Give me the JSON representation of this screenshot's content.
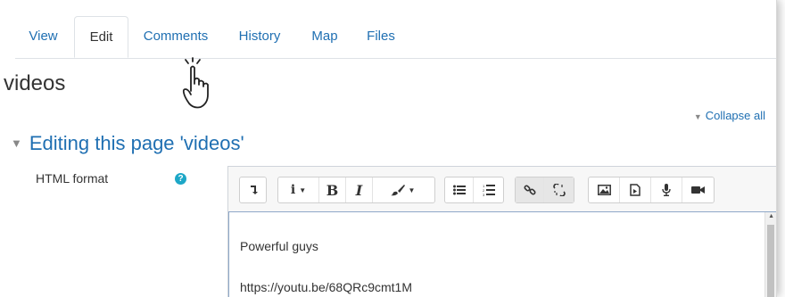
{
  "tabs": [
    {
      "label": "View"
    },
    {
      "label": "Edit"
    },
    {
      "label": "Comments"
    },
    {
      "label": "History"
    },
    {
      "label": "Map"
    },
    {
      "label": "Files"
    }
  ],
  "active_tab": "Edit",
  "page": {
    "title": "videos"
  },
  "collapse_all": "Collapse all",
  "section": {
    "heading": "Editing this page 'videos'"
  },
  "field": {
    "label": "HTML format",
    "help_icon": "question-icon"
  },
  "toolbar": {
    "icons": [
      "toggle-toolbar-icon",
      "info-icon",
      "bold-icon",
      "italic-icon",
      "paintbrush-icon",
      "bullet-list-icon",
      "numbered-list-icon",
      "link-icon",
      "unlink-icon",
      "image-icon",
      "media-file-icon",
      "microphone-icon",
      "video-camera-icon"
    ],
    "bold": "B",
    "italic": "I"
  },
  "editor": {
    "lines": [
      "Powerful guys",
      "https://youtu.be/68QRc9cmt1M"
    ]
  },
  "colors": {
    "link": "#1f6fb2",
    "help": "#1da7c7"
  }
}
